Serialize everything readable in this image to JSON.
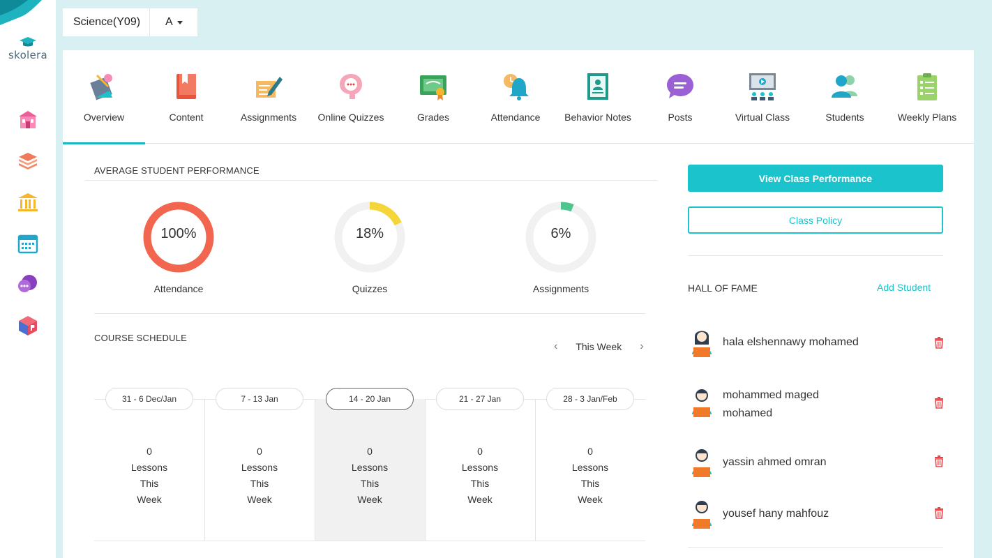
{
  "sidebar": {
    "logo_text": "skolera",
    "items": [
      {
        "icon": "school-icon",
        "color": "#ef5d98"
      },
      {
        "icon": "books-stack-icon",
        "color": "#f07a5a"
      },
      {
        "icon": "institution-icon",
        "color": "#f5b62e"
      },
      {
        "icon": "calendar-icon",
        "color": "#1fa6c9"
      },
      {
        "icon": "chat-icon",
        "color": "#8a3fbf"
      },
      {
        "icon": "cube-p-icon",
        "color": "#e84a5f"
      }
    ]
  },
  "class_selector": {
    "subject": "Science(Y09)",
    "section": "A"
  },
  "tabs": [
    {
      "label": "Overview",
      "icon": "overview-icon",
      "active": true
    },
    {
      "label": "Content",
      "icon": "book-icon"
    },
    {
      "label": "Assignments",
      "icon": "pen-paper-icon"
    },
    {
      "label": "Online Quizzes",
      "icon": "quiz-bubble-icon"
    },
    {
      "label": "Grades",
      "icon": "certificate-icon"
    },
    {
      "label": "Attendance",
      "icon": "bell-clock-icon"
    },
    {
      "label": "Behavior Notes",
      "icon": "notebook-user-icon"
    },
    {
      "label": "Posts",
      "icon": "message-icon"
    },
    {
      "label": "Virtual Class",
      "icon": "projector-class-icon"
    },
    {
      "label": "Students",
      "icon": "students-icon"
    },
    {
      "label": "Weekly Plans",
      "icon": "clipboard-list-icon"
    }
  ],
  "performance": {
    "title": "AVERAGE STUDENT PERFORMANCE",
    "gauges": [
      {
        "label": "Attendance",
        "value_text": "100%",
        "value": 1.0
      },
      {
        "label": "Quizzes",
        "value_text": "18%",
        "value": 0.18
      },
      {
        "label": "Assignments",
        "value_text": "6%",
        "value": 0.06
      }
    ]
  },
  "schedule": {
    "title": "COURSE SCHEDULE",
    "nav_label": "This Week",
    "prev": "‹",
    "next": "›",
    "weeks": [
      {
        "range": "31 - 6 Dec/Jan",
        "count": "0",
        "l1": "Lessons",
        "l2": "This",
        "l3": "Week"
      },
      {
        "range": "7 - 13 Jan",
        "count": "0",
        "l1": "Lessons",
        "l2": "This",
        "l3": "Week"
      },
      {
        "range": "14 - 20 Jan",
        "count": "0",
        "l1": "Lessons",
        "l2": "This",
        "l3": "Week",
        "selected": true
      },
      {
        "range": "21 - 27 Jan",
        "count": "0",
        "l1": "Lessons",
        "l2": "This",
        "l3": "Week"
      },
      {
        "range": "28 - 3 Jan/Feb",
        "count": "0",
        "l1": "Lessons",
        "l2": "This",
        "l3": "Week"
      }
    ]
  },
  "actions": {
    "view_performance": "View Class Performance",
    "class_policy": "Class Policy"
  },
  "hall_of_fame": {
    "title": "HALL OF FAME",
    "add_label": "Add Student",
    "students": [
      {
        "name": "hala elshennawy mohamed",
        "avatar": "student-female-avatar"
      },
      {
        "name": "mohammed maged mohamed",
        "avatar": "student-male-avatar"
      },
      {
        "name": "yassin ahmed omran",
        "avatar": "student-male-avatar"
      },
      {
        "name": "yousef hany mahfouz",
        "avatar": "student-male-avatar"
      }
    ]
  },
  "colors": {
    "accent": "#1bc3cc",
    "attendance_gauge": "#f2654e",
    "quiz_gauge": "#f4d63a",
    "assignment_gauge": "#4ec48e",
    "delete": "#e8474a"
  }
}
